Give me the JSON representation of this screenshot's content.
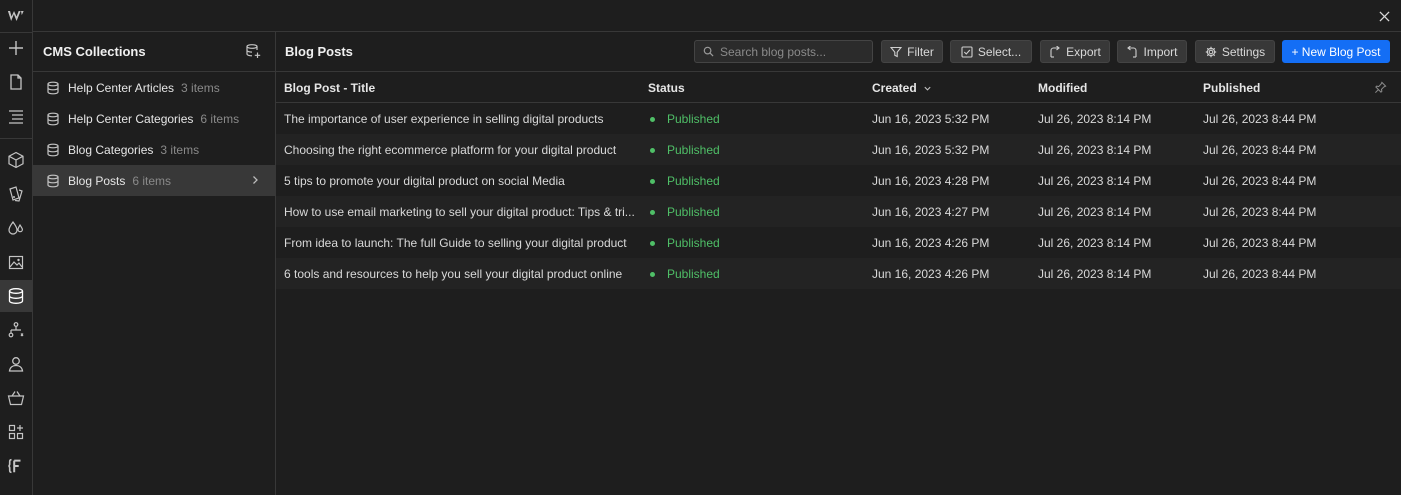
{
  "topbar": {},
  "collections": {
    "title": "CMS Collections",
    "items": [
      {
        "name": "Help Center Articles",
        "count": "3 items"
      },
      {
        "name": "Help Center Categories",
        "count": "6 items"
      },
      {
        "name": "Blog Categories",
        "count": "3 items"
      },
      {
        "name": "Blog Posts",
        "count": "6 items"
      }
    ]
  },
  "main": {
    "title": "Blog Posts",
    "search_placeholder": "Search blog posts...",
    "buttons": {
      "filter": "Filter",
      "select": "Select...",
      "export": "Export",
      "import": "Import",
      "settings": "Settings",
      "new_post": "+ New Blog Post"
    }
  },
  "table": {
    "columns": {
      "title": "Blog Post - Title",
      "status": "Status",
      "created": "Created",
      "modified": "Modified",
      "published": "Published"
    },
    "rows": [
      {
        "title": "The importance of user experience in selling digital products",
        "status": "Published",
        "created": "Jun 16, 2023 5:32 PM",
        "modified": "Jul 26, 2023 8:14 PM",
        "published": "Jul 26, 2023 8:44 PM"
      },
      {
        "title": "Choosing the right ecommerce platform for your digital product",
        "status": "Published",
        "created": "Jun 16, 2023 5:32 PM",
        "modified": "Jul 26, 2023 8:14 PM",
        "published": "Jul 26, 2023 8:44 PM"
      },
      {
        "title": "5 tips to promote your digital product on social Media",
        "status": "Published",
        "created": "Jun 16, 2023 4:28 PM",
        "modified": "Jul 26, 2023 8:14 PM",
        "published": "Jul 26, 2023 8:44 PM"
      },
      {
        "title": "How to use email marketing to sell your digital product: Tips & tri...",
        "status": "Published",
        "created": "Jun 16, 2023 4:27 PM",
        "modified": "Jul 26, 2023 8:14 PM",
        "published": "Jul 26, 2023 8:44 PM"
      },
      {
        "title": "From idea to launch: The full Guide to selling your digital product",
        "status": "Published",
        "created": "Jun 16, 2023 4:26 PM",
        "modified": "Jul 26, 2023 8:14 PM",
        "published": "Jul 26, 2023 8:44 PM"
      },
      {
        "title": "6 tools and resources to help you sell your digital product online",
        "status": "Published",
        "created": "Jun 16, 2023 4:26 PM",
        "modified": "Jul 26, 2023 8:14 PM",
        "published": "Jul 26, 2023 8:44 PM"
      }
    ]
  },
  "colors": {
    "background": "#1e1e1e",
    "accent": "#146ef5",
    "published": "#4fbf67",
    "border": "#383838"
  },
  "icons": {
    "rail": [
      "webflow-logo-icon",
      "add-icon",
      "pages-icon",
      "navigator-icon",
      "components-icon",
      "style-guide-icon",
      "variables-icon",
      "assets-icon",
      "cms-icon",
      "logic-icon",
      "users-icon",
      "ecommerce-icon",
      "apps-icon",
      "finsweet-icon"
    ]
  }
}
